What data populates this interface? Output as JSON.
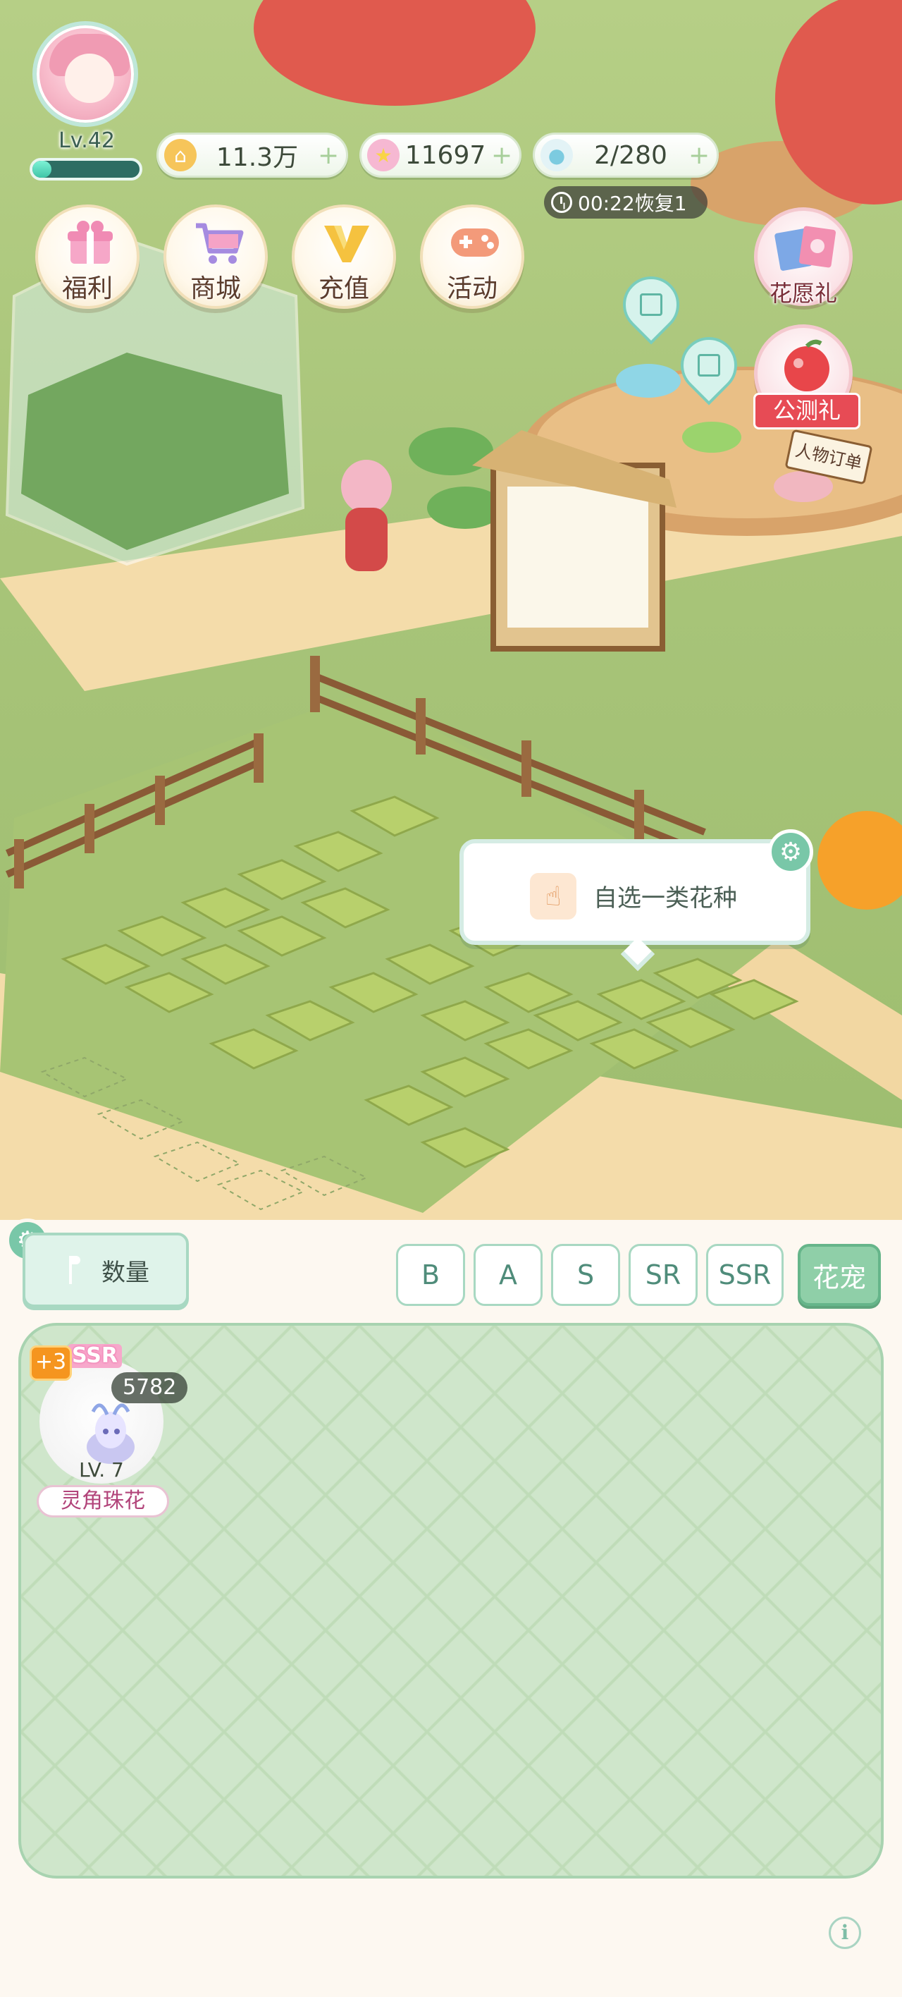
{
  "player": {
    "level": "Lv.42",
    "exp_fraction": 0.18
  },
  "resources": {
    "gold": "11.3万",
    "stars": "11697",
    "water": "2/280",
    "recover_timer": "00:22恢复1"
  },
  "menu": {
    "welfare": "福利",
    "shop": "商城",
    "recharge": "充值",
    "events": "活动"
  },
  "side": {
    "flower_wish": "花愿礼",
    "public_test": "公测礼"
  },
  "scene_labels": {
    "order_board": "人物订单"
  },
  "tooltip": {
    "text": "自选一类花种"
  },
  "panel": {
    "quantity_label": "数量",
    "filters": [
      "B",
      "A",
      "S",
      "SR",
      "SSR",
      "花宠"
    ],
    "active_filter": "花宠"
  },
  "cards": [
    {
      "rarity": "SSR",
      "plus": "+3",
      "count": "5782",
      "level": "LV. 7",
      "name": "灵角珠花"
    }
  ],
  "colors": {
    "accent_green": "#8fcfa8",
    "panel_bg": "#cfe6cb",
    "name_pink": "#b2447a",
    "ribbon_red": "#e74b55"
  }
}
